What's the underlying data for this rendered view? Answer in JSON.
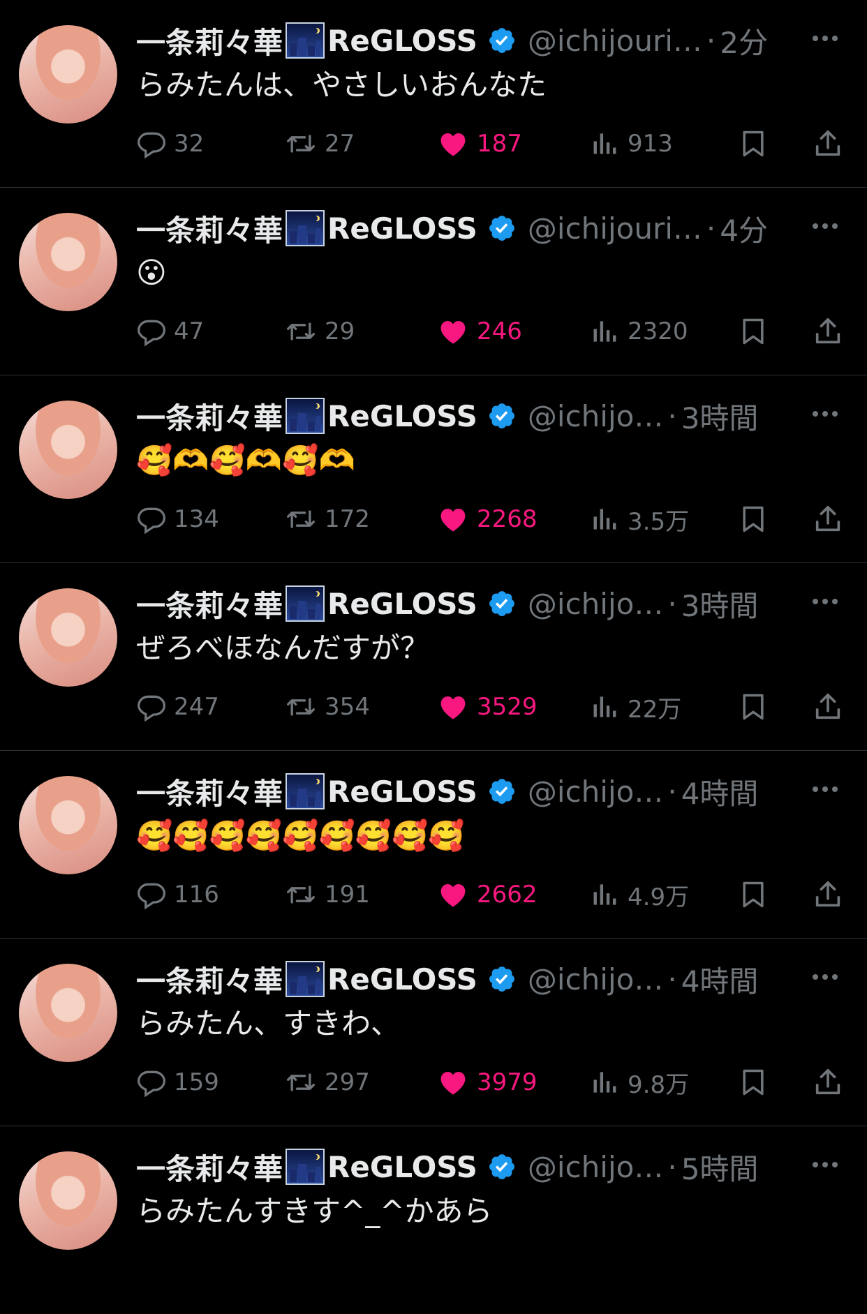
{
  "colors": {
    "background": "#000000",
    "text": "#e7e9ea",
    "muted": "#71767b",
    "like": "#f91880",
    "verified": "#1d9bf0",
    "divider": "#2f3336"
  },
  "icons": {
    "reply": "reply-icon",
    "retweet": "retweet-icon",
    "like": "heart-icon",
    "views": "views-icon",
    "bookmark": "bookmark-icon",
    "share": "share-icon",
    "more": "more-icon",
    "verified": "verified-badge-icon"
  },
  "tweets": [
    {
      "name": "一条莉々華",
      "suffix": "ReGLOSS",
      "handle": "@ichijouri…",
      "dot": "·",
      "time": "2分",
      "text": "らみたんは、やさしいおんなた",
      "replies": "32",
      "retweets": "27",
      "likes": "187",
      "views": "913"
    },
    {
      "name": "一条莉々華",
      "suffix": "ReGLOSS",
      "handle": "@ichijouri…",
      "dot": "·",
      "time": "4分",
      "text": "😮",
      "replies": "47",
      "retweets": "29",
      "likes": "246",
      "views": "2320"
    },
    {
      "name": "一条莉々華",
      "suffix": "ReGLOSS",
      "handle": "@ichijo…",
      "dot": "·",
      "time": "3時間",
      "text": "🥰🫶🥰🫶🥰🫶",
      "replies": "134",
      "retweets": "172",
      "likes": "2268",
      "views": "3.5万"
    },
    {
      "name": "一条莉々華",
      "suffix": "ReGLOSS",
      "handle": "@ichijo…",
      "dot": "·",
      "time": "3時間",
      "text": "ぜろべほなんだすが？",
      "replies": "247",
      "retweets": "354",
      "likes": "3529",
      "views": "22万"
    },
    {
      "name": "一条莉々華",
      "suffix": "ReGLOSS",
      "handle": "@ichijo…",
      "dot": "·",
      "time": "4時間",
      "text": "🥰🥰🥰🥰🥰🥰🥰🥰🥰",
      "replies": "116",
      "retweets": "191",
      "likes": "2662",
      "views": "4.9万"
    },
    {
      "name": "一条莉々華",
      "suffix": "ReGLOSS",
      "handle": "@ichijo…",
      "dot": "·",
      "time": "4時間",
      "text": "らみたん、すきわ、",
      "replies": "159",
      "retweets": "297",
      "likes": "3979",
      "views": "9.8万"
    },
    {
      "name": "一条莉々華",
      "suffix": "ReGLOSS",
      "handle": "@ichijo…",
      "dot": "·",
      "time": "5時間",
      "text": "らみたんすきす^_^かあら",
      "replies": "",
      "retweets": "",
      "likes": "",
      "views": ""
    }
  ]
}
